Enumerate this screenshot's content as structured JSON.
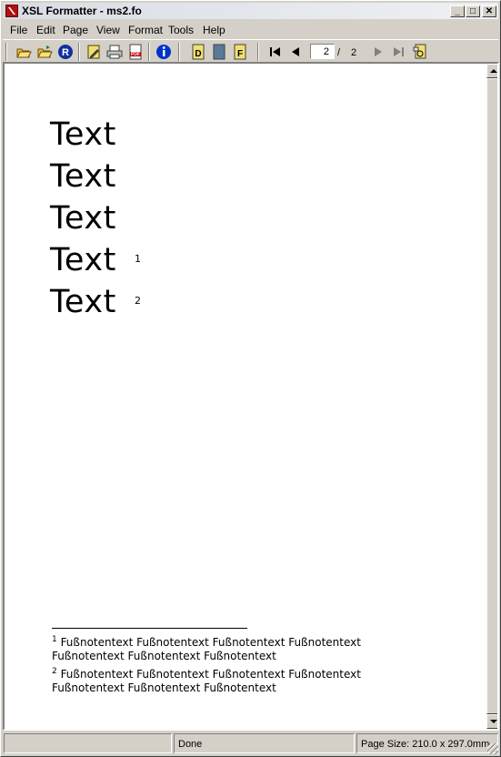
{
  "window": {
    "title": "XSL Formatter - ms2.fo"
  },
  "window_controls": {
    "minimize": "_",
    "maximize": "□",
    "close": "✕"
  },
  "menu": [
    "File",
    "Edit",
    "Page",
    "View",
    "Format",
    "Tools",
    "Help"
  ],
  "toolbar": {
    "page_current": "2",
    "page_separator": "/",
    "page_total": "2",
    "icons": [
      "open-icon",
      "open-recent-icon",
      "render-icon",
      "edit-icon",
      "print-icon",
      "pdf-icon",
      "info-icon",
      "d-view-icon",
      "page-view-icon",
      "f-view-icon",
      "first-page-icon",
      "prev-page-icon",
      "next-page-icon",
      "last-page-icon",
      "goto-page-icon"
    ]
  },
  "document": {
    "lines": [
      "Text",
      "Text",
      "Text",
      "Text",
      "Text"
    ],
    "footnote_refs": [
      "1",
      "2"
    ],
    "footnotes": [
      {
        "marker": "1",
        "line1": "Fußnotentext Fußnotentext Fußnotentext Fußnotentext",
        "line2": "Fußnotentext Fußnotentext Fußnotentext"
      },
      {
        "marker": "2",
        "line1": "Fußnotentext Fußnotentext Fußnotentext Fußnotentext",
        "line2": "Fußnotentext Fußnotentext Fußnotentext"
      }
    ]
  },
  "status": {
    "left": "",
    "middle": "Done",
    "right": "Page Size: 210.0 x 297.0mm"
  },
  "colors": {
    "titlebar": "#d9dde4",
    "face": "#d4d0c8",
    "shadow": "#808080",
    "page": "#ffffff",
    "info_blue": "#0033cc",
    "pdf_red": "#c00000"
  }
}
